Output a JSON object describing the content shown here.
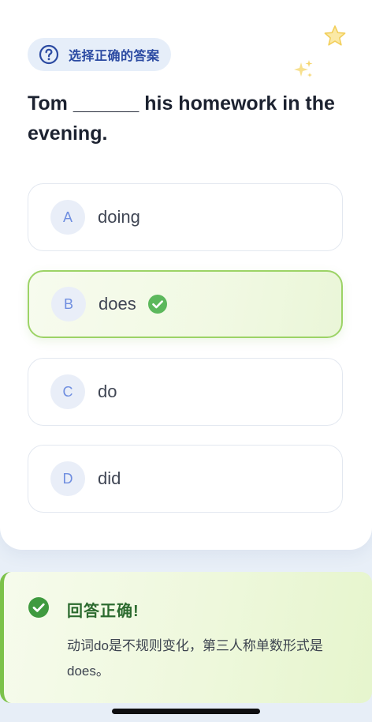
{
  "badge": {
    "label": "选择正确的答案",
    "icon": "question-circle-icon"
  },
  "decorations": {
    "star_icon": "star-icon",
    "sparkle_icon": "sparkle-icon"
  },
  "question": {
    "text": "Tom ______ his homework in the evening."
  },
  "options": [
    {
      "letter": "A",
      "text": "doing",
      "state": "default"
    },
    {
      "letter": "B",
      "text": "does",
      "state": "correct",
      "icon": "check-circle-icon"
    },
    {
      "letter": "C",
      "text": "do",
      "state": "default"
    },
    {
      "letter": "D",
      "text": "did",
      "state": "default"
    }
  ],
  "feedback": {
    "title": "回答正确!",
    "body": "动词do是不规则变化，第三人称单数形式是does。",
    "icon": "check-circle-icon"
  },
  "colors": {
    "accent_blue": "#2b4aa2",
    "correct_green": "#5cb85c",
    "correct_border": "#9cd366"
  }
}
